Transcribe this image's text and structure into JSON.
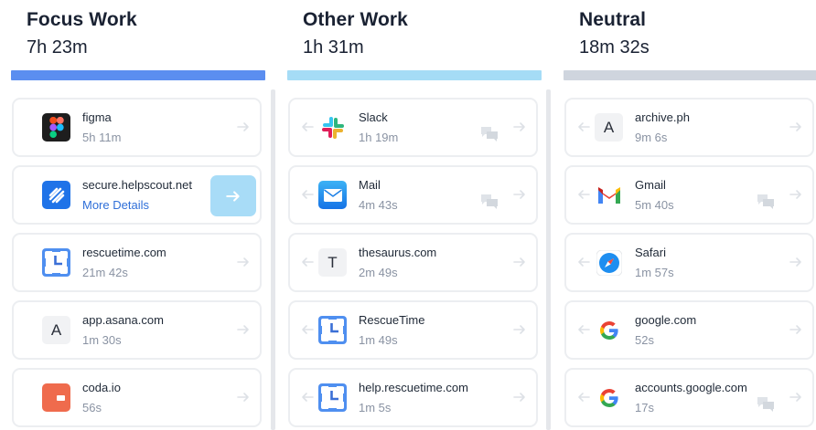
{
  "columns": [
    {
      "title": "Focus Work",
      "total": "7h 23m",
      "bar_color": "#5b8ef0",
      "items": [
        {
          "name": "figma",
          "time": "5h 11m",
          "icon": "figma-icon"
        },
        {
          "name": "secure.helpscout.net",
          "time": "More Details",
          "icon": "helpscout-icon"
        },
        {
          "name": "rescuetime.com",
          "time": "21m 42s",
          "icon": "rescuetime-icon"
        },
        {
          "name": "app.asana.com",
          "time": "1m 30s",
          "icon": "letter-icon",
          "letter": "A"
        },
        {
          "name": "coda.io",
          "time": "56s",
          "icon": "coda-icon"
        }
      ]
    },
    {
      "title": "Other Work",
      "total": "1h 31m",
      "bar_color": "#a5dcf6",
      "items": [
        {
          "name": "Slack",
          "time": "1h 19m",
          "icon": "slack-icon"
        },
        {
          "name": "Mail",
          "time": "4m 43s",
          "icon": "mail-icon"
        },
        {
          "name": "thesaurus.com",
          "time": "2m 49s",
          "icon": "letter-icon",
          "letter": "T"
        },
        {
          "name": "RescueTime",
          "time": "1m 49s",
          "icon": "rescuetime-icon"
        },
        {
          "name": "help.rescuetime.com",
          "time": "1m 5s",
          "icon": "rescuetime-icon"
        }
      ]
    },
    {
      "title": "Neutral",
      "total": "18m 32s",
      "bar_color": "#cfd5de",
      "items": [
        {
          "name": "archive.ph",
          "time": "9m 6s",
          "icon": "letter-icon",
          "letter": "A"
        },
        {
          "name": "Gmail",
          "time": "5m 40s",
          "icon": "gmail-icon"
        },
        {
          "name": "Safari",
          "time": "1m 57s",
          "icon": "safari-icon"
        },
        {
          "name": "google.com",
          "time": "52s",
          "icon": "google-icon"
        },
        {
          "name": "accounts.google.com",
          "time": "17s",
          "icon": "google-icon"
        }
      ]
    }
  ],
  "colors": {
    "link": "#2f6fd8",
    "move_button": "#a8dcf7",
    "muted_text": "#8a93a3"
  }
}
